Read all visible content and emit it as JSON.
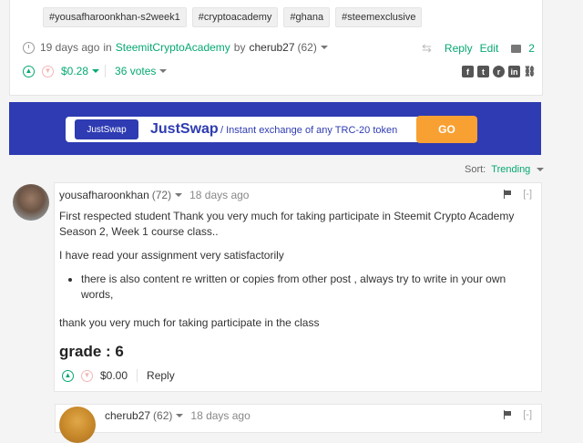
{
  "post": {
    "tags": [
      "#yousafharoonkhan-s2week1",
      "#cryptoacademy",
      "#ghana",
      "#steemexclusive"
    ],
    "age": "19 days ago",
    "in_word": "in",
    "community": "SteemitCryptoAcademy",
    "by_word": "by",
    "author": "cherub27",
    "reputation": "(62)",
    "reply_label": "Reply",
    "edit_label": "Edit",
    "comment_count": "2",
    "payout": "$0.28",
    "votes": "36 votes"
  },
  "banner": {
    "logo_text": "JustSwap",
    "title": "JustSwap",
    "subtitle": "/ Instant exchange of any TRC-20 token",
    "button": "GO",
    "bg_color": "#2e3bb2",
    "button_color": "#f9a033"
  },
  "sort": {
    "label": "Sort:",
    "value": "Trending"
  },
  "comment": {
    "author": "yousafharoonkhan",
    "reputation": "(72)",
    "age": "18 days ago",
    "collapse": "[-]",
    "paragraph1": "First respected student Thank you very much for taking participate in Steemit Crypto Academy Season 2, Week 1 course class..",
    "paragraph2": "I have read your assignment very satisfactorily",
    "bullet": "there is also content re written or copies from other post , always try to write in your own words,",
    "paragraph3": "thank you very much for taking participate in the class",
    "grade": "grade : 6",
    "payout": "$0.00",
    "reply_label": "Reply"
  },
  "reply": {
    "author": "cherub27",
    "reputation": "(62)",
    "age": "18 days ago",
    "collapse": "[-]"
  },
  "colors": {
    "accent": "#06a971"
  }
}
